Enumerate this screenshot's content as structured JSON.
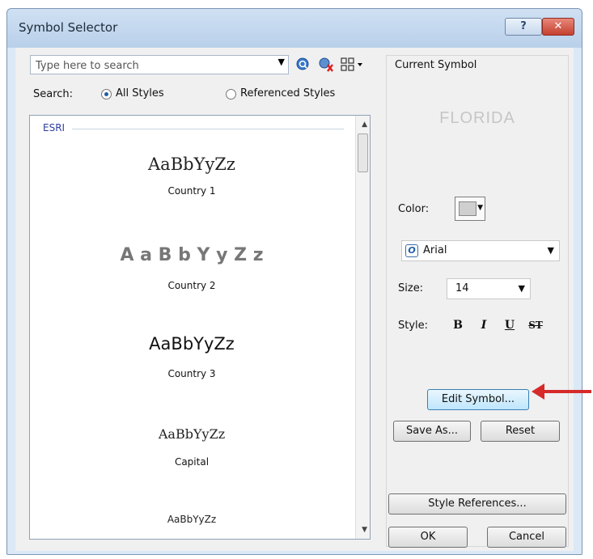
{
  "window": {
    "title": "Symbol Selector",
    "help_label": "?",
    "close_label": "✕"
  },
  "search": {
    "placeholder": "Type here to search",
    "label": "Search:",
    "options": [
      "All Styles",
      "Referenced Styles"
    ],
    "selected": "All Styles"
  },
  "symbol_list": {
    "group": "ESRI",
    "items": [
      {
        "sample": "AaBbYyZz",
        "label": "Country 1"
      },
      {
        "sample": "A a B b Y y Z z",
        "label": "Country 2"
      },
      {
        "sample": "AaBbYyZz",
        "label": "Country 3"
      },
      {
        "sample": "AaBbYyZz",
        "label": "Capital"
      },
      {
        "sample": "AaBbYyZz",
        "label": ""
      }
    ]
  },
  "current_symbol": {
    "label": "Current Symbol",
    "preview": "FLORIDA",
    "color_label": "Color:",
    "color_value": "#cfcfcf",
    "font": "Arial",
    "size_label": "Size:",
    "size": "14",
    "style_label": "Style:",
    "style_buttons": [
      "B",
      "I",
      "U",
      "ST"
    ]
  },
  "buttons": {
    "edit_symbol": "Edit Symbol...",
    "save_as": "Save As...",
    "reset": "Reset",
    "style_references": "Style References...",
    "ok": "OK",
    "cancel": "Cancel"
  },
  "colors": {
    "annotation_arrow": "#d62a2a"
  }
}
